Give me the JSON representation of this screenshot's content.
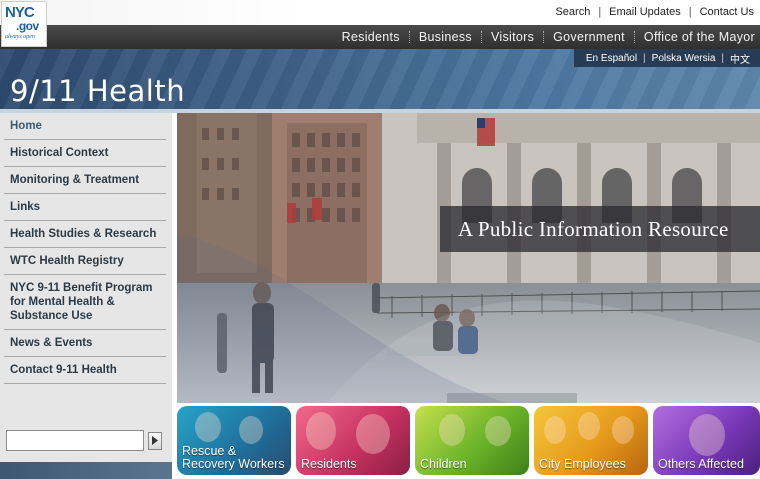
{
  "logo": {
    "line1": "NYC",
    "line2": ".gov",
    "tagline": "always open"
  },
  "top_links": [
    "Search",
    "Email Updates",
    "Contact Us"
  ],
  "nav": [
    "Residents",
    "Business",
    "Visitors",
    "Government",
    "Office of the Mayor"
  ],
  "languages": [
    "En Español",
    "Polska Wersia",
    "中文"
  ],
  "banner": {
    "title": "9/11 Health"
  },
  "sidebar": {
    "items": [
      {
        "label": "Home"
      },
      {
        "label": "Historical Context"
      },
      {
        "label": "Monitoring & Treatment"
      },
      {
        "label": "Links"
      },
      {
        "label": "Health Studies & Research"
      },
      {
        "label": "WTC Health Registry"
      },
      {
        "label": "NYC 9-11 Benefit Program for Mental Health & Substance Use"
      },
      {
        "label": "News & Events"
      },
      {
        "label": "Contact 9-11 Health"
      }
    ],
    "search": {
      "value": "",
      "go_icon": "arrow-right-icon"
    }
  },
  "hero": {
    "caption": "A Public Information Resource"
  },
  "tiles": [
    {
      "label": "Rescue & Recovery Workers",
      "color": "#1f6e9a"
    },
    {
      "label": "Residents",
      "color": "#c83363"
    },
    {
      "label": "Children",
      "color": "#6cb42a"
    },
    {
      "label": "City Employees",
      "color": "#e69a1c"
    },
    {
      "label": "Others Affected",
      "color": "#7a39b8"
    }
  ]
}
